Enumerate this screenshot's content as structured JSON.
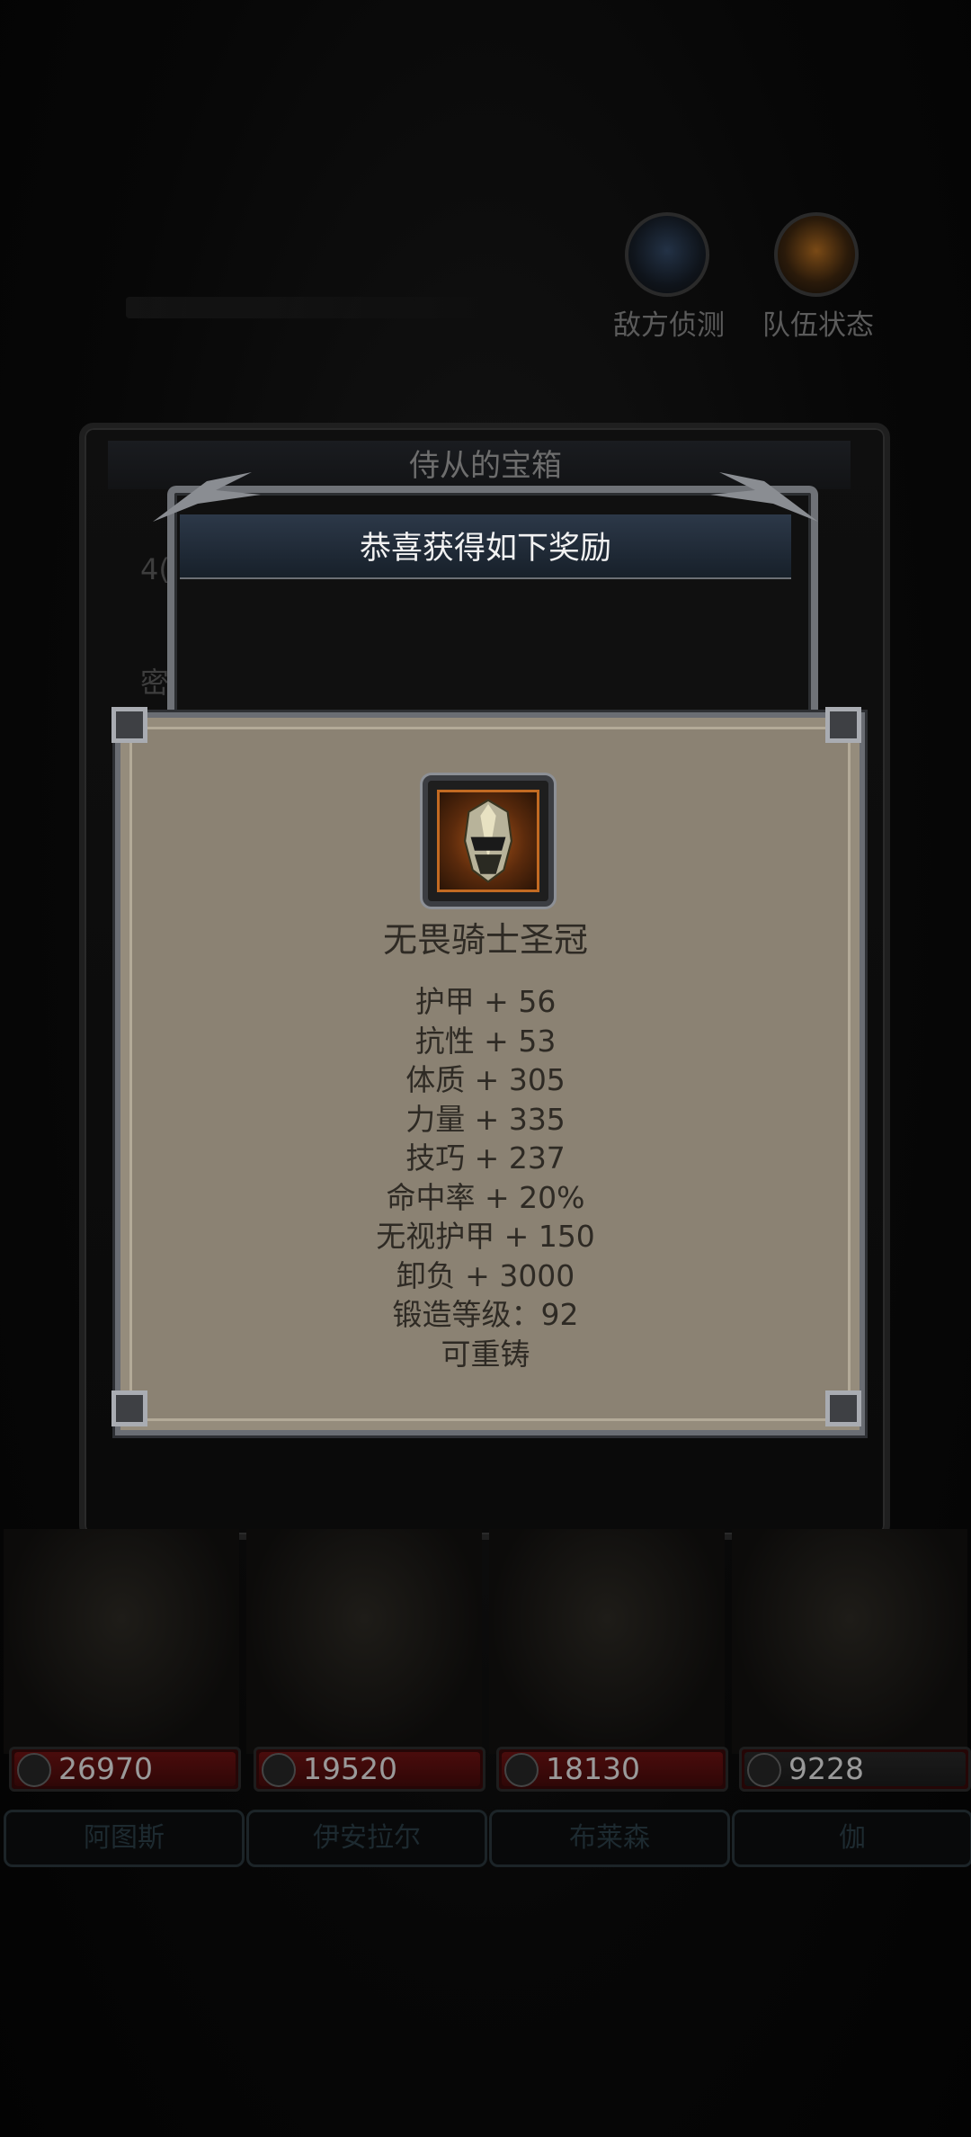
{
  "top_buttons": [
    {
      "label": "敌方侦测",
      "icon": "radar-orb-icon"
    },
    {
      "label": "队伍状态",
      "icon": "team-status-orb-icon"
    }
  ],
  "background_panel": {
    "title": "侍从的宝箱",
    "side_text_1": "4(",
    "side_text_2": "密"
  },
  "reward_dialog": {
    "title": "恭喜获得如下奖励"
  },
  "item": {
    "icon": "knight-helmet-icon",
    "name": "无畏骑士圣冠",
    "stats": [
      "护甲 + 56",
      "抗性 + 53",
      "体质 + 305",
      "力量 + 335",
      "技巧 + 237",
      "命中率 + 20%",
      "无视护甲 + 150",
      "卸负 + 3000",
      "锻造等级：92",
      "可重铸"
    ]
  },
  "characters": [
    {
      "name": "阿图斯",
      "power": "26970"
    },
    {
      "name": "伊安拉尔",
      "power": "19520"
    },
    {
      "name": "布莱森",
      "power": "18130"
    },
    {
      "name": "伽",
      "power": "9228"
    }
  ]
}
